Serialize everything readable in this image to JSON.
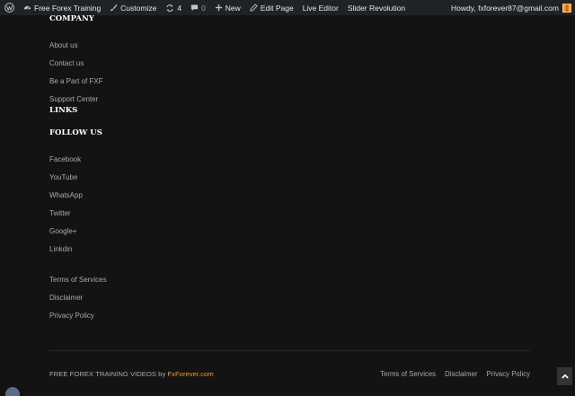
{
  "admin_bar": {
    "site_name": "Free Forex Training",
    "customize": "Customize",
    "updates_count": "4",
    "comments_count": "0",
    "new": "New",
    "edit_page": "Edit Page",
    "live_editor": "Live Editor",
    "slider_revolution": "Slider Revolution",
    "greeting": "Howdy, fxforever87@gmail.com"
  },
  "footer": {
    "company": {
      "heading": "COMPANY",
      "links": [
        "About us",
        "Contact us",
        "Be a Part of FXF",
        "Support Center"
      ]
    },
    "links_heading": "LINKS",
    "follow": {
      "heading": "FOLLOW US",
      "links": [
        "Facebook",
        "YouTube",
        "WhatsApp",
        "Twitter",
        "Google+",
        "Linkdin"
      ]
    },
    "legal_links": [
      "Terms of Services",
      "Disclaimer",
      "Privacy Policy"
    ],
    "copyright_text": "FREE FOREX TRAINING VIDEOS by ",
    "copyright_brand": "FxForever.com",
    "bottom_links": [
      "Terms of Services",
      "Disclaimer",
      "Privacy Policy"
    ]
  },
  "colors": {
    "background": "#131314",
    "admin_bar": "#1d2327",
    "brand_accent": "#f29a1d"
  }
}
